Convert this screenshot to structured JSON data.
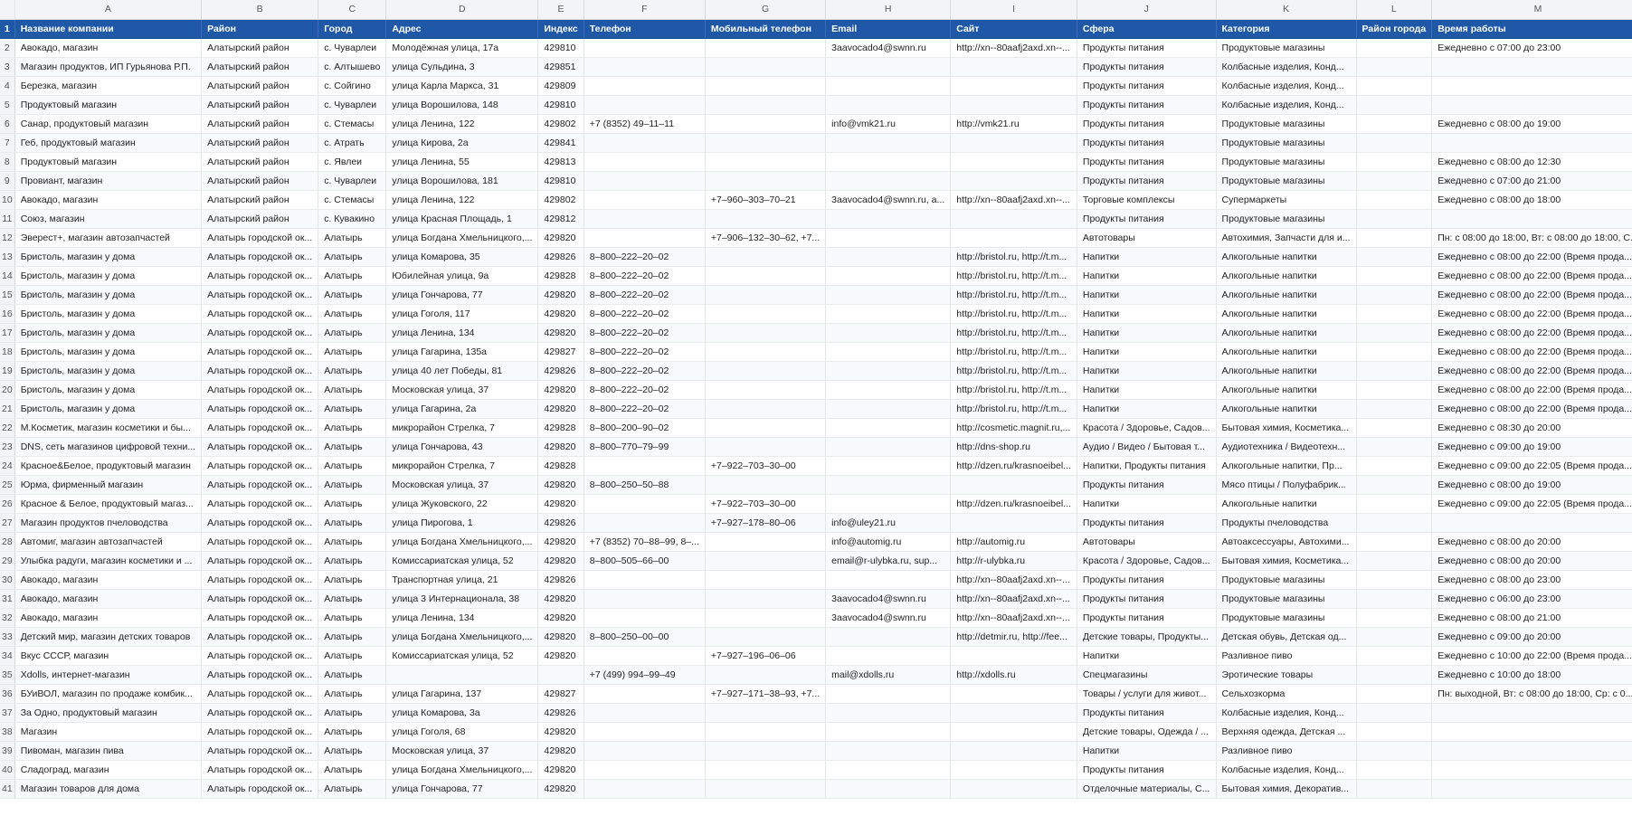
{
  "colors": {
    "header_bg": "#1f58a7",
    "header_text": "#ffffff",
    "band": "#f7f9fc",
    "grid": "#e2e5ea"
  },
  "column_letters": [
    "A",
    "B",
    "C",
    "D",
    "E",
    "F",
    "G",
    "H",
    "I",
    "J",
    "K",
    "L",
    "M"
  ],
  "rows": [
    {
      "n": "1",
      "cells": [
        "Название компании",
        "Район",
        "Город",
        "Адрес",
        "Индекс",
        "Телефон",
        "Мобильный телефон",
        "Email",
        "Сайт",
        "Сфера",
        "Категория",
        "Район города",
        "Время работы"
      ]
    },
    {
      "n": "2",
      "cells": [
        "Авокадо, магазин",
        "Алатырский район",
        "с. Чуварлеи",
        "Молодёжная улица, 17а",
        "429810",
        "",
        "",
        "3aavocado4@swnn.ru",
        "http://xn--80aafj2axd.xn--...",
        "Продукты питания",
        "Продуктовые магазины",
        "",
        "Ежедневно с 07:00 до 23:00"
      ]
    },
    {
      "n": "3",
      "cells": [
        "Магазин продуктов, ИП Гурьянова Р.П.",
        "Алатырский район",
        "с. Алтышево",
        "улица Сульдина, 3",
        "429851",
        "",
        "",
        "",
        "",
        "Продукты питания",
        "Колбасные изделия, Конд...",
        "",
        ""
      ]
    },
    {
      "n": "4",
      "cells": [
        "Березка, магазин",
        "Алатырский район",
        "с. Сойгино",
        "улица Карла Маркса, 31",
        "429809",
        "",
        "",
        "",
        "",
        "Продукты питания",
        "Колбасные изделия, Конд...",
        "",
        ""
      ]
    },
    {
      "n": "5",
      "cells": [
        "Продуктовый магазин",
        "Алатырский район",
        "с. Чуварлеи",
        "улица Ворошилова, 148",
        "429810",
        "",
        "",
        "",
        "",
        "Продукты питания",
        "Колбасные изделия, Конд...",
        "",
        ""
      ]
    },
    {
      "n": "6",
      "cells": [
        "Санар, продуктовый магазин",
        "Алатырский район",
        "с. Стемасы",
        "улица Ленина, 122",
        "429802",
        "+7 (8352) 49–11–11",
        "",
        "info@vmk21.ru",
        "http://vmk21.ru",
        "Продукты питания",
        "Продуктовые магазины",
        "",
        "Ежедневно с 08:00 до 19:00"
      ]
    },
    {
      "n": "7",
      "cells": [
        "Геб, продуктовый магазин",
        "Алатырский район",
        "с. Атрать",
        "улица Кирова, 2а",
        "429841",
        "",
        "",
        "",
        "",
        "Продукты питания",
        "Продуктовые магазины",
        "",
        ""
      ]
    },
    {
      "n": "8",
      "cells": [
        "Продуктовый магазин",
        "Алатырский район",
        "с. Явлеи",
        "улица Ленина, 55",
        "429813",
        "",
        "",
        "",
        "",
        "Продукты питания",
        "Продуктовые магазины",
        "",
        "Ежедневно с 08:00 до 12:30"
      ]
    },
    {
      "n": "9",
      "cells": [
        "Провиант, магазин",
        "Алатырский район",
        "с. Чуварлеи",
        "улица Ворошилова, 181",
        "429810",
        "",
        "",
        "",
        "",
        "Продукты питания",
        "Продуктовые магазины",
        "",
        "Ежедневно с 07:00 до 21:00"
      ]
    },
    {
      "n": "10",
      "cells": [
        "Авокадо, магазин",
        "Алатырский район",
        "с. Стемасы",
        "улица Ленина, 122",
        "429802",
        "",
        "+7–960–303–70–21",
        "3aavocado4@swnn.ru, a...",
        "http://xn--80aafj2axd.xn--...",
        "Торговые комплексы",
        "Супермаркеты",
        "",
        "Ежедневно с 08:00 до 18:00"
      ]
    },
    {
      "n": "11",
      "cells": [
        "Союз, магазин",
        "Алатырский район",
        "с. Кувакино",
        "улица Красная Площадь, 1",
        "429812",
        "",
        "",
        "",
        "",
        "Продукты питания",
        "Продуктовые магазины",
        "",
        ""
      ]
    },
    {
      "n": "12",
      "cells": [
        "Эверест+, магазин автозапчастей",
        "Алатырь городской ок...",
        "Алатырь",
        "улица Богдана Хмельницкого,...",
        "429820",
        "",
        "+7–906–132–30–62, +7...",
        "",
        "",
        "Автотовары",
        "Автохимия, Запчасти для и...",
        "",
        "Пн: с 08:00 до 18:00, Вт: с 08:00 до 18:00, С..."
      ]
    },
    {
      "n": "13",
      "cells": [
        "Бристоль, магазин у дома",
        "Алатырь городской ок...",
        "Алатырь",
        "улица Комарова, 35",
        "429826",
        "8–800–222–20–02",
        "",
        "",
        "http://bristol.ru, http://t.m...",
        "Напитки",
        "Алкогольные напитки",
        "",
        "Ежедневно с 08:00 до 22:00 (Время прода..."
      ]
    },
    {
      "n": "14",
      "cells": [
        "Бристоль, магазин у дома",
        "Алатырь городской ок...",
        "Алатырь",
        "Юбилейная улица, 9а",
        "429828",
        "8–800–222–20–02",
        "",
        "",
        "http://bristol.ru, http://t.m...",
        "Напитки",
        "Алкогольные напитки",
        "",
        "Ежедневно с 08:00 до 22:00 (Время прода..."
      ]
    },
    {
      "n": "15",
      "cells": [
        "Бристоль, магазин у дома",
        "Алатырь городской ок...",
        "Алатырь",
        "улица Гончарова, 77",
        "429820",
        "8–800–222–20–02",
        "",
        "",
        "http://bristol.ru, http://t.m...",
        "Напитки",
        "Алкогольные напитки",
        "",
        "Ежедневно с 08:00 до 22:00 (Время прода..."
      ]
    },
    {
      "n": "16",
      "cells": [
        "Бристоль, магазин у дома",
        "Алатырь городской ок...",
        "Алатырь",
        "улица Гоголя, 117",
        "429820",
        "8–800–222–20–02",
        "",
        "",
        "http://bristol.ru, http://t.m...",
        "Напитки",
        "Алкогольные напитки",
        "",
        "Ежедневно с 08:00 до 22:00 (Время прода..."
      ]
    },
    {
      "n": "17",
      "cells": [
        "Бристоль, магазин у дома",
        "Алатырь городской ок...",
        "Алатырь",
        "улица Ленина, 134",
        "429820",
        "8–800–222–20–02",
        "",
        "",
        "http://bristol.ru, http://t.m...",
        "Напитки",
        "Алкогольные напитки",
        "",
        "Ежедневно с 08:00 до 22:00 (Время прода..."
      ]
    },
    {
      "n": "18",
      "cells": [
        "Бристоль, магазин у дома",
        "Алатырь городской ок...",
        "Алатырь",
        "улица Гагарина, 135а",
        "429827",
        "8–800–222–20–02",
        "",
        "",
        "http://bristol.ru, http://t.m...",
        "Напитки",
        "Алкогольные напитки",
        "",
        "Ежедневно с 08:00 до 22:00 (Время прода..."
      ]
    },
    {
      "n": "19",
      "cells": [
        "Бристоль, магазин у дома",
        "Алатырь городской ок...",
        "Алатырь",
        "улица 40 лет Победы, 81",
        "429826",
        "8–800–222–20–02",
        "",
        "",
        "http://bristol.ru, http://t.m...",
        "Напитки",
        "Алкогольные напитки",
        "",
        "Ежедневно с 08:00 до 22:00 (Время прода..."
      ]
    },
    {
      "n": "20",
      "cells": [
        "Бристоль, магазин у дома",
        "Алатырь городской ок...",
        "Алатырь",
        "Московская улица, 37",
        "429820",
        "8–800–222–20–02",
        "",
        "",
        "http://bristol.ru, http://t.m...",
        "Напитки",
        "Алкогольные напитки",
        "",
        "Ежедневно с 08:00 до 22:00 (Время прода..."
      ]
    },
    {
      "n": "21",
      "cells": [
        "Бристоль, магазин у дома",
        "Алатырь городской ок...",
        "Алатырь",
        "улица Гагарина, 2а",
        "429820",
        "8–800–222–20–02",
        "",
        "",
        "http://bristol.ru, http://t.m...",
        "Напитки",
        "Алкогольные напитки",
        "",
        "Ежедневно с 08:00 до 22:00 (Время прода..."
      ]
    },
    {
      "n": "22",
      "cells": [
        "М.Косметик, магазин косметики и бы...",
        "Алатырь городской ок...",
        "Алатырь",
        "микрорайон Стрелка, 7",
        "429828",
        "8–800–200–90–02",
        "",
        "",
        "http://cosmetic.magnit.ru,...",
        "Красота / Здоровье, Садов...",
        "Бытовая химия, Косметика...",
        "",
        "Ежедневно с 08:30 до 20:00"
      ]
    },
    {
      "n": "23",
      "cells": [
        "DNS, сеть магазинов цифровой техни...",
        "Алатырь городской ок...",
        "Алатырь",
        "улица Гончарова, 43",
        "429820",
        "8–800–770–79–99",
        "",
        "",
        "http://dns-shop.ru",
        "Аудио / Видео / Бытовая т...",
        "Аудиотехника / Видеотехн...",
        "",
        "Ежедневно с 09:00 до 19:00"
      ]
    },
    {
      "n": "24",
      "cells": [
        "Красное&Белое, продуктовый магазин",
        "Алатырь городской ок...",
        "Алатырь",
        "микрорайон Стрелка, 7",
        "429828",
        "",
        "+7–922–703–30–00",
        "",
        "http://dzen.ru/krasnoeibel...",
        "Напитки, Продукты питания",
        "Алкогольные напитки, Пр...",
        "",
        "Ежедневно с 09:00 до 22:05 (Время прода..."
      ]
    },
    {
      "n": "25",
      "cells": [
        "Юрма, фирменный магазин",
        "Алатырь городской ок...",
        "Алатырь",
        "Московская улица, 37",
        "429820",
        "8–800–250–50–88",
        "",
        "",
        "",
        "Продукты питания",
        "Мясо птицы / Полуфабрик...",
        "",
        "Ежедневно с 08:00 до 19:00"
      ]
    },
    {
      "n": "26",
      "cells": [
        "Красное & Белое, продуктовый магаз...",
        "Алатырь городской ок...",
        "Алатырь",
        "улица Жуковского, 22",
        "429820",
        "",
        "+7–922–703–30–00",
        "",
        "http://dzen.ru/krasnoeibel...",
        "Напитки",
        "Алкогольные напитки",
        "",
        "Ежедневно с 09:00 до 22:05 (Время прода..."
      ]
    },
    {
      "n": "27",
      "cells": [
        "Магазин продуктов пчеловодства",
        "Алатырь городской ок...",
        "Алатырь",
        "улица Пирогова, 1",
        "429826",
        "",
        "+7–927–178–80–06",
        "info@uley21.ru",
        "",
        "Продукты питания",
        "Продукты пчеловодства",
        "",
        ""
      ]
    },
    {
      "n": "28",
      "cells": [
        "Автомиг, магазин автозапчастей",
        "Алатырь городской ок...",
        "Алатырь",
        "улица Богдана Хмельницкого,...",
        "429820",
        "+7 (8352) 70–88–99, 8–...",
        "",
        "info@automig.ru",
        "http://automig.ru",
        "Автотовары",
        "Автоаксессуары, Автохими...",
        "",
        "Ежедневно с 08:00 до 20:00"
      ]
    },
    {
      "n": "29",
      "cells": [
        "Улыбка радуги, магазин косметики и ...",
        "Алатырь городской ок...",
        "Алатырь",
        "Комиссариатская улица, 52",
        "429820",
        "8–800–505–66–00",
        "",
        "email@r-ulybka.ru, sup...",
        "http://r-ulybka.ru",
        "Красота / Здоровье, Садов...",
        "Бытовая химия, Косметика...",
        "",
        "Ежедневно с 08:00 до 20:00"
      ]
    },
    {
      "n": "30",
      "cells": [
        "Авокадо, магазин",
        "Алатырь городской ок...",
        "Алатырь",
        "Транспортная улица, 21",
        "429826",
        "",
        "",
        "",
        "http://xn--80aafj2axd.xn--...",
        "Продукты питания",
        "Продуктовые магазины",
        "",
        "Ежедневно с 08:00 до 23:00"
      ]
    },
    {
      "n": "31",
      "cells": [
        "Авокадо, магазин",
        "Алатырь городской ок...",
        "Алатырь",
        "улица 3 Интернационала, 38",
        "429820",
        "",
        "",
        "3aavocado4@swnn.ru",
        "http://xn--80aafj2axd.xn--...",
        "Продукты питания",
        "Продуктовые магазины",
        "",
        "Ежедневно с 06:00 до 23:00"
      ]
    },
    {
      "n": "32",
      "cells": [
        "Авокадо, магазин",
        "Алатырь городской ок...",
        "Алатырь",
        "улица Ленина, 134",
        "429820",
        "",
        "",
        "3aavocado4@swnn.ru",
        "http://xn--80aafj2axd.xn--...",
        "Продукты питания",
        "Продуктовые магазины",
        "",
        "Ежедневно с 08:00 до 21:00"
      ]
    },
    {
      "n": "33",
      "cells": [
        "Детский мир, магазин детских товаров",
        "Алатырь городской ок...",
        "Алатырь",
        "улица Богдана Хмельницкого,...",
        "429820",
        "8–800–250–00–00",
        "",
        "",
        "http://detmir.ru, http://fee...",
        "Детские товары, Продукты...",
        "Детская обувь, Детская од...",
        "",
        "Ежедневно с 09:00 до 20:00"
      ]
    },
    {
      "n": "34",
      "cells": [
        "Вкус СССР, магазин",
        "Алатырь городской ок...",
        "Алатырь",
        "Комиссариатская улица, 52",
        "429820",
        "",
        "+7–927–196–06–06",
        "",
        "",
        "Напитки",
        "Разливное пиво",
        "",
        "Ежедневно с 10:00 до 22:00 (Время прода..."
      ]
    },
    {
      "n": "35",
      "cells": [
        "Xdolls, интернет-магазин",
        "Алатырь городской ок...",
        "Алатырь",
        "",
        "",
        "+7 (499) 994–99–49",
        "",
        "mail@xdolls.ru",
        "http://xdolls.ru",
        "Спецмагазины",
        "Эротические товары",
        "",
        "Ежедневно с 10:00 до 18:00"
      ]
    },
    {
      "n": "36",
      "cells": [
        "БУиВОЛ, магазин по продаже комбик...",
        "Алатырь городской ок...",
        "Алатырь",
        "улица Гагарина, 137",
        "429827",
        "",
        "+7–927–171–38–93, +7...",
        "",
        "",
        "Товары / услуги для живот...",
        "Сельхозкорма",
        "",
        "Пн: выходной, Вт: с 08:00 до 18:00, Ср: с 0..."
      ]
    },
    {
      "n": "37",
      "cells": [
        "За Одно, продуктовый магазин",
        "Алатырь городской ок...",
        "Алатырь",
        "улица Комарова, 3а",
        "429826",
        "",
        "",
        "",
        "",
        "Продукты питания",
        "Колбасные изделия, Конд...",
        "",
        ""
      ]
    },
    {
      "n": "38",
      "cells": [
        "Магазин",
        "Алатырь городской ок...",
        "Алатырь",
        "улица Гоголя, 68",
        "429820",
        "",
        "",
        "",
        "",
        "Детские товары, Одежда / ...",
        "Верхняя одежда, Детская ...",
        "",
        ""
      ]
    },
    {
      "n": "39",
      "cells": [
        "Пивоман, магазин пива",
        "Алатырь городской ок...",
        "Алатырь",
        "Московская улица, 37",
        "429820",
        "",
        "",
        "",
        "",
        "Напитки",
        "Разливное пиво",
        "",
        ""
      ]
    },
    {
      "n": "40",
      "cells": [
        "Сладоград, магазин",
        "Алатырь городской ок...",
        "Алатырь",
        "улица Богдана Хмельницкого,...",
        "429820",
        "",
        "",
        "",
        "",
        "Продукты питания",
        "Колбасные изделия, Конд...",
        "",
        ""
      ]
    },
    {
      "n": "41",
      "cells": [
        "Магазин товаров для дома",
        "Алатырь городской ок...",
        "Алатырь",
        "улица Гончарова, 77",
        "429820",
        "",
        "",
        "",
        "",
        "Отделочные материалы, С...",
        "Бытовая химия, Декоратив...",
        "",
        ""
      ]
    }
  ]
}
